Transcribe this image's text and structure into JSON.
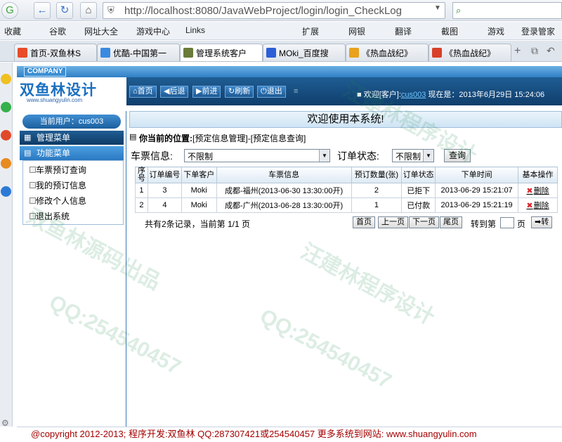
{
  "browser": {
    "url": "http://localhost:8080/JavaWebProject/login/login_CheckLog",
    "bookmarks": [
      "收藏",
      "谷歌",
      "网址大全",
      "游戏中心",
      "Links",
      "扩展",
      "网银",
      "翻译",
      "截图",
      "游戏",
      "登录管家"
    ],
    "tabs": [
      {
        "title": "首页-双鱼林S",
        "color": "#e84c2a"
      },
      {
        "title": "优酷-中国第一",
        "color": "#3a8be0"
      },
      {
        "title": "管理系统客户",
        "color": "#6b7b3a"
      },
      {
        "title": "MOki_百度搜",
        "color": "#2c5fd6"
      },
      {
        "title": "《热血战纪》",
        "color": "#e8a21d"
      },
      {
        "title": "《热血战纪》",
        "color": "#d8402a"
      }
    ]
  },
  "app": {
    "company": "COMPANY",
    "logo": "双鱼林设计",
    "logo_url": "www.shuangyulin.com",
    "toolbar": [
      {
        "icon": "home-icon",
        "label": "首页"
      },
      {
        "icon": "back-icon",
        "label": "后退"
      },
      {
        "icon": "forward-icon",
        "label": "前进"
      },
      {
        "icon": "refresh-icon",
        "label": "刷新"
      },
      {
        "icon": "power-icon",
        "label": "退出"
      }
    ],
    "welcome": {
      "prefix": "欢迎[客户]:",
      "user": "cus003",
      "date_text": "现在是：2013年6月29日 15:24:06"
    },
    "current_user": "当前用户：cus003",
    "mgmt_menu": "管理菜单",
    "func_menu": "功能菜单",
    "menu_items": [
      "车票预订查询",
      "我的预订信息",
      "修改个人信息",
      "退出系统"
    ],
    "banner": "欢迎使用本系统!",
    "location_label": "你当前的位置:",
    "location_path": "[预定信息管理]-[预定信息查询]",
    "filter": {
      "ticket_label": "车票信息:",
      "ticket_value": "不限制",
      "status_label": "订单状态:",
      "status_value": "不限制",
      "query_button": "查询"
    },
    "table": {
      "headers": [
        "序号",
        "订单编号",
        "下单客户",
        "车票信息",
        "预订数量(张)",
        "订单状态",
        "下单时间",
        "基本操作"
      ],
      "rows": [
        [
          "1",
          "3",
          "Moki",
          "成都-福州(2013-06-30 13:30:00开)",
          "2",
          "已拒下",
          "2013-06-29 15:21:07",
          "删除"
        ],
        [
          "2",
          "4",
          "Moki",
          "成都-广州(2013-06-28 13:30:00开)",
          "1",
          "已付款",
          "2013-06-29 15:21:19",
          "删除"
        ]
      ]
    },
    "pager": {
      "summary": "共有2条记录，当前第 1/1 页",
      "first": "首页",
      "prev": "上一页",
      "next": "下一页",
      "last": "尾页",
      "goto_label": "转到第",
      "page_suffix": "页",
      "go": "转"
    },
    "footer": "@copyright 2012-2013; 程序开发:双鱼林  QQ:287307421或254540457  更多系统到网站: www.shuangyulin.com"
  },
  "watermarks": [
    "汪建林程序设计",
    "双鱼林源码出品",
    "QQ:254540457"
  ]
}
